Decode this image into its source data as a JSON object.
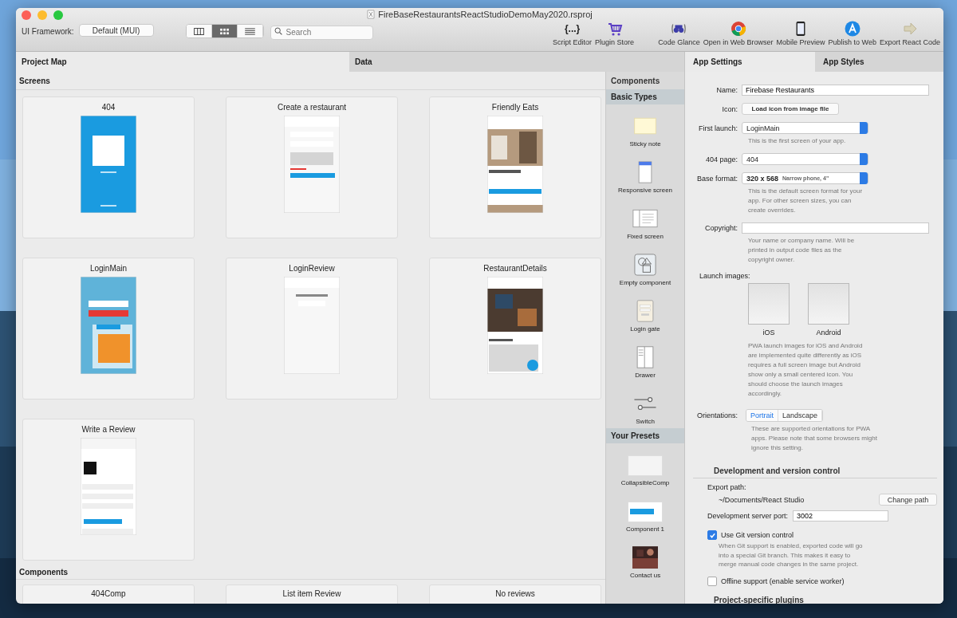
{
  "window": {
    "title": "FireBaseRestaurantsReactStudioDemoMay2020.rsproj"
  },
  "toolbar": {
    "framework_label": "UI Framework:",
    "framework_value": "Default (MUI)",
    "view_modes": [
      {
        "kind": "columns",
        "selected": false
      },
      {
        "kind": "grid",
        "selected": true
      },
      {
        "kind": "list",
        "selected": false
      }
    ],
    "search": {
      "placeholder": "Search"
    },
    "tool_groups": [
      [
        {
          "label": "Script Editor",
          "kind": "glyph",
          "glyph": "{...}"
        },
        {
          "label": "Plugin Store",
          "kind": "cart"
        }
      ],
      [
        {
          "label": "Code Glance",
          "kind": "binoculars"
        },
        {
          "label": "Open in Web Browser",
          "kind": "browser"
        },
        {
          "label": "Mobile Preview",
          "kind": "phone"
        },
        {
          "label": "Publish to Web",
          "kind": "publish"
        },
        {
          "label": "Export React Code",
          "kind": "export"
        }
      ]
    ]
  },
  "main_tabs": [
    {
      "label": "Project Map",
      "selected": true
    },
    {
      "label": "Data",
      "selected": false
    }
  ],
  "screens_heading": "Screens",
  "screens": [
    {
      "title": "404"
    },
    {
      "title": "Create a restaurant"
    },
    {
      "title": "Friendly Eats"
    },
    {
      "title": "LoginMain"
    },
    {
      "title": "LoginReview"
    },
    {
      "title": "RestaurantDetails"
    },
    {
      "title": "Write a Review"
    }
  ],
  "components_heading": "Components",
  "components": [
    {
      "title": "404Comp"
    },
    {
      "title": "List item  Review"
    },
    {
      "title": "No reviews"
    }
  ],
  "palette": {
    "heading": "Components",
    "sections": [
      {
        "title": "Basic Types",
        "items": [
          {
            "label": "Sticky note",
            "kind": "sticky"
          },
          {
            "label": "Responsive screen",
            "kind": "responsive"
          },
          {
            "label": "Fixed screen",
            "kind": "fixed"
          },
          {
            "label": "Empty component",
            "kind": "empty"
          },
          {
            "label": "Login gate",
            "kind": "login"
          },
          {
            "label": "Drawer",
            "kind": "drawer"
          },
          {
            "label": "Switch",
            "kind": "switch"
          }
        ]
      },
      {
        "title": "Your Presets",
        "items": [
          {
            "label": "CollapsibleComp",
            "kind": "blank"
          },
          {
            "label": "Component 1",
            "kind": "button"
          },
          {
            "label": "Contact us"
          }
        ]
      }
    ]
  },
  "settings_tabs": [
    {
      "label": "App Settings",
      "selected": true
    },
    {
      "label": "App Styles",
      "selected": false
    }
  ],
  "settings": {
    "name": {
      "label": "Name:",
      "value": "Firebase Restaurants"
    },
    "icon": {
      "label": "Icon:",
      "button": "Load icon from image file"
    },
    "first_launch": {
      "label": "First launch:",
      "value": "LoginMain",
      "hint": "This is the first screen of your app."
    },
    "page_404": {
      "label": "404 page:",
      "value": "404"
    },
    "base_format": {
      "label": "Base format:",
      "value": "320 x 568",
      "detail": "Narrow phone, 4\"",
      "hint": "This is the default screen format for your app. For other screen sizes, you can create overrides."
    },
    "copyright": {
      "label": "Copyright:",
      "hint": "Your name or company name. Will be printed in output code files as the copyright owner."
    },
    "launch_images": {
      "label": "Launch images:",
      "items": [
        "iOS",
        "Android"
      ],
      "hint": "PWA launch images for iOS and Android are implemented quite differently as iOS requires a full screen image but Android show only a small centered icon. You should choose the launch images accordingly."
    },
    "orientations": {
      "label": "Orientations:",
      "options": [
        {
          "label": "Portrait",
          "selected": true
        },
        {
          "label": "Landscape",
          "selected": false
        }
      ],
      "hint": "These are supported orientations for PWA apps. Please note that some browsers might ignore this setting."
    },
    "dev_heading": "Development and version control",
    "export_path": {
      "label": "Export path:",
      "value": "~/Documents/React Studio",
      "button": "Change path"
    },
    "port": {
      "label": "Development server port:",
      "value": "3002"
    },
    "git": {
      "label": "Use Git version control",
      "checked": true,
      "hint": "When Git support is enabled, exported code will go into a special Git branch. This makes it easy to merge manual code changes in the same project."
    },
    "offline": {
      "label": "Offline support (enable service worker)",
      "checked": false
    },
    "plugins_heading": "Project-specific plugins"
  }
}
